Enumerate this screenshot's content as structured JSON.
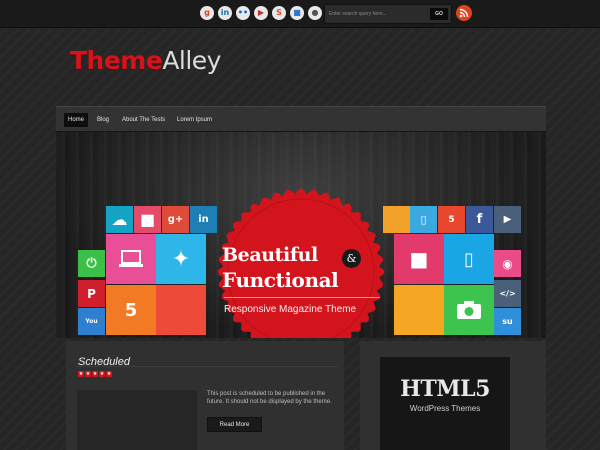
{
  "topbar": {
    "social_icons": [
      {
        "name": "google-icon",
        "glyph": "g",
        "color": "#d6422e"
      },
      {
        "name": "linkedin-icon",
        "glyph": "in",
        "color": "#0e76a8"
      },
      {
        "name": "flickr-icon",
        "glyph": "••",
        "color": "#0063dc"
      },
      {
        "name": "youtube-icon",
        "glyph": "▶",
        "color": "#c4302b"
      },
      {
        "name": "stumbleupon-icon",
        "glyph": "S",
        "color": "#eb4823"
      },
      {
        "name": "delicious-icon",
        "glyph": "■",
        "color": "#3274d1"
      },
      {
        "name": "reddit-icon",
        "glyph": "●",
        "color": "#555555"
      }
    ],
    "search_placeholder": "Enter search query here...",
    "search_button": "GO",
    "rss_icon": "rss-icon"
  },
  "logo": {
    "part1": "Theme",
    "part2": "Alley"
  },
  "nav": {
    "items": [
      {
        "label": "Home",
        "active": true
      },
      {
        "label": "Blog",
        "active": false
      },
      {
        "label": "About The Tests",
        "active": false
      },
      {
        "label": "Lorem Ipsum",
        "active": false
      }
    ]
  },
  "slider": {
    "line1": "Beautiful",
    "amp": "&",
    "line2": "Functional",
    "subtitle": "Responsive Magazine Theme",
    "badge_color": "#d4141c"
  },
  "post": {
    "title": "Scheduled",
    "stars": 5,
    "excerpt": "This post is scheduled to be published in the future. It should not be displayed by the theme.",
    "read_more": "Read More"
  },
  "sidebar": {
    "ad_title": "HTML5",
    "ad_subtitle": "WordPress Themes"
  },
  "colors": {
    "accent": "#d4141c",
    "background": "#262626"
  }
}
